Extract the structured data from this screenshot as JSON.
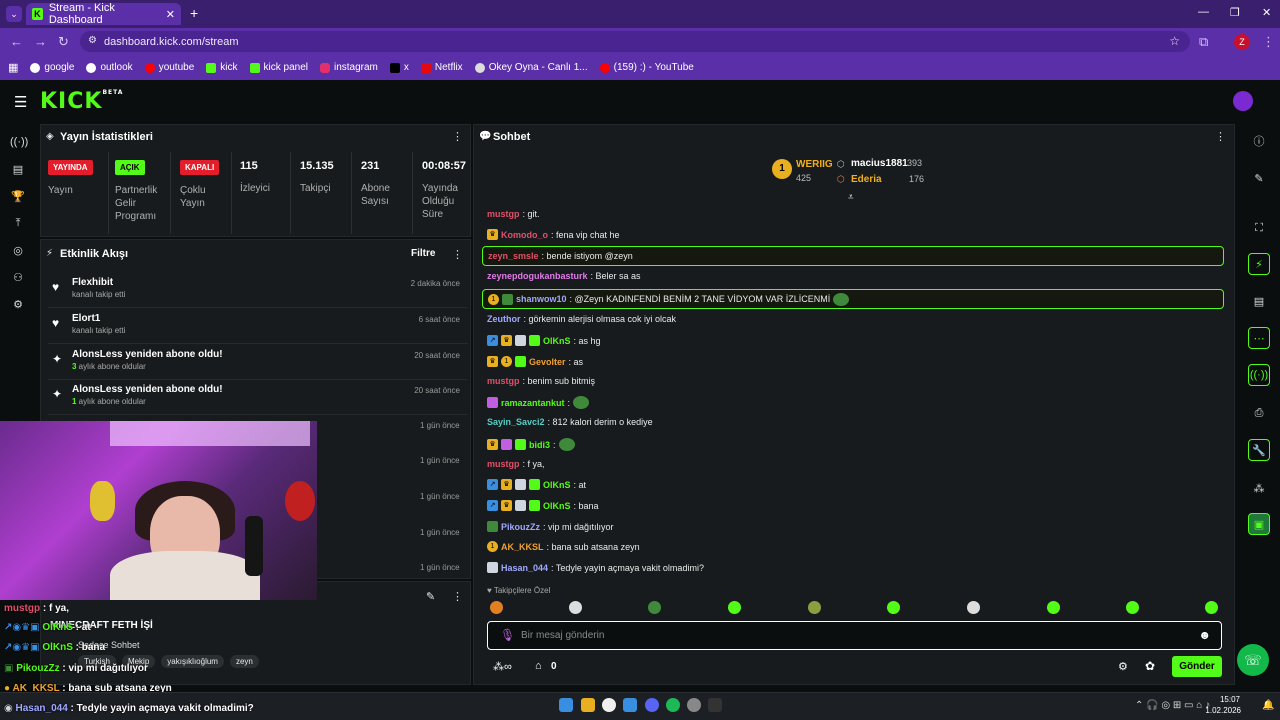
{
  "browser": {
    "tab_title": "Stream - Kick Dashboard",
    "url": "dashboard.kick.com/stream",
    "profile_initial": "Z",
    "bookmarks": [
      "google",
      "outlook",
      "youtube",
      "kick",
      "kick panel",
      "instagram",
      "x",
      "Netflix",
      "Okey Oyna - Canlı 1...",
      "(159) :) - YouTube"
    ]
  },
  "kick": {
    "logo": "KICK",
    "beta": "BETA"
  },
  "stats": {
    "title": "Yayın İstatistikleri",
    "live_badge": "YAYINDA",
    "live_label": "Yayın",
    "partner_badge": "AÇIK",
    "partner_label": "Partnerlik Gelir Programı",
    "multi_badge": "KAPALI",
    "multi_label": "Çoklu Yayın",
    "viewers": "115",
    "viewers_label": "İzleyici",
    "followers": "15.135",
    "followers_label": "Takipçi",
    "subs": "231",
    "subs_label": "Abone Sayısı",
    "uptime": "00:08:57",
    "uptime_label": "Yayında Olduğu Süre"
  },
  "activity": {
    "title": "Etkinlik Akışı",
    "filter": "Filtre",
    "items": [
      {
        "name": "Flexhibit",
        "sub": "kanalı takip etti",
        "time": "2 dakika önce",
        "icon": "heart-icon"
      },
      {
        "name": "Elort1",
        "sub": "kanalı takip etti",
        "time": "6 saat önce",
        "icon": "heart-icon"
      },
      {
        "name": "AlonsLess yeniden abone oldu!",
        "num": "3",
        "sub": " aylık abone oldular",
        "time": "20 saat önce",
        "icon": "sparkle-icon"
      },
      {
        "name": "AlonsLess yeniden abone oldu!",
        "num": "1",
        "sub": " aylık abone oldular",
        "time": "20 saat önce",
        "icon": "sparkle-icon"
      }
    ],
    "more_times": [
      "1 gün önce",
      "1 gün önce",
      "1 gün önce",
      "1 gün önce",
      "1 gün önce"
    ]
  },
  "chat": {
    "title": "Sohbet",
    "leaderboard": [
      {
        "rank": "1",
        "name": "WERIIG",
        "count": "425"
      },
      {
        "name": "macius1881",
        "count": "393"
      },
      {
        "name": "Ederia",
        "count": "176"
      }
    ],
    "messages": [
      {
        "user": "mustgp",
        "text": ": git.",
        "color": "#e0506a"
      },
      {
        "user": "Komodo_o",
        "text": ": fena vip chat he",
        "color": "#e0506a"
      },
      {
        "user": "zeyn_smsle",
        "text": ": bende istiyom @zeyn",
        "color": "#e0506a"
      },
      {
        "user": "zeynepdogukanbasturk",
        "text": ": Beler sa as",
        "color": "#e07ae8"
      },
      {
        "user": "shanwow10",
        "text": ": @Zeyn KADINFENDİ BENİM 2 TANE VİDYOM VAR İZLİCENMİ",
        "color": "#9fa8ff"
      },
      {
        "user": "Zeuthor",
        "text": ": görkemin alerjisi olmasa cok iyi olcak",
        "color": "#9fa8ff"
      },
      {
        "user": "OlKnS",
        "text": ": as hg",
        "color": "#53fc18"
      },
      {
        "user": "Gevolter",
        "text": ": as",
        "color": "#f0a030"
      },
      {
        "user": "mustgp",
        "text": ": benim sub bitmiş",
        "color": "#e0506a"
      },
      {
        "user": "ramazantankut",
        "text": ":",
        "color": "#53fc18"
      },
      {
        "user": "Sayin_Savci2",
        "text": ": 812 kalori derim o kediye",
        "color": "#53d0c8"
      },
      {
        "user": "bidi3",
        "text": ":",
        "color": "#53fc18"
      },
      {
        "user": "mustgp",
        "text": ": f ya,",
        "color": "#e0506a"
      },
      {
        "user": "OlKnS",
        "text": ": at",
        "color": "#53fc18"
      },
      {
        "user": "OlKnS",
        "text": ": bana",
        "color": "#53fc18"
      },
      {
        "user": "PikouzZz",
        "text": ": vip mi dağıtılıyor",
        "color": "#9fa8ff"
      },
      {
        "user": "AK_KKSL",
        "text": ": bana sub atsana zeyn",
        "color": "#f0a030"
      },
      {
        "user": "Hasan_044",
        "text": ": Tedyle yayin açmaya vakit olmadimi?",
        "color": "#9fa8ff"
      }
    ],
    "followers_only": "Takipçilere Özel",
    "input_placeholder": "Bir mesaj gönderin",
    "points": "0",
    "send": "Gönder"
  },
  "overlay": {
    "lines": [
      {
        "user": "mustgp",
        "text": " : f ya,",
        "color": "#e0506a"
      },
      {
        "user": "OlKnS",
        "text": " : at",
        "color": "#53fc18"
      },
      {
        "user": "OlKnS",
        "text": " : bana",
        "color": "#53fc18"
      },
      {
        "user": "PikouzZz",
        "text": " : vip mi dağıtılıyor",
        "color": "#53fc18"
      },
      {
        "user": "AK_KKSL",
        "text": " : bana sub atsana zeyn",
        "color": "#f0a030"
      },
      {
        "user": "Hasan_044",
        "text": " : Tedyle yayin açmaya vakit olmadimi?",
        "color": "#9fa8ff"
      }
    ],
    "stream_title": "MINECRAFT FETH İŞİ",
    "category": "Sadece Sohbet",
    "tags": [
      "Turkish",
      "Mekip",
      "yakışıklıoğlum",
      "zeyn"
    ]
  },
  "taskbar": {
    "time": "15:07",
    "date": "1.02.2026"
  },
  "colors": {
    "accent": "#53fc18",
    "browser": "#5b2fa8",
    "panel": "#181b1d"
  }
}
